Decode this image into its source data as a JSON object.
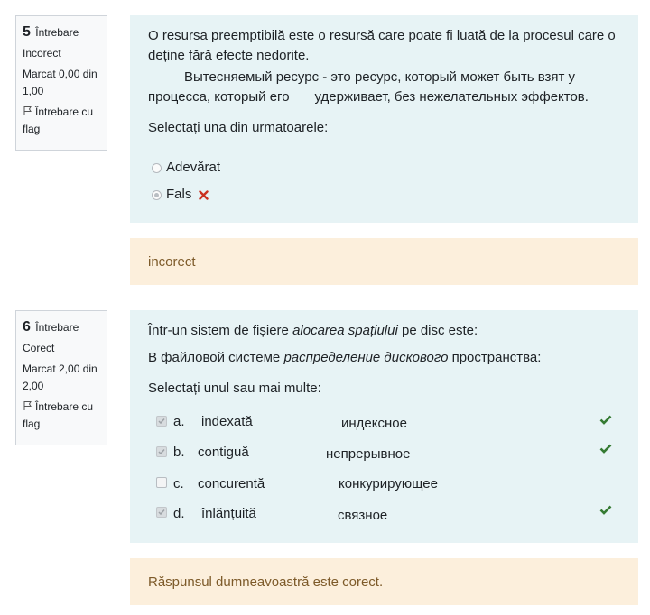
{
  "q5": {
    "number": "5",
    "label": "Întrebare",
    "state": "Incorect",
    "mark": "Marcat 0,00 din 1,00",
    "flag": "Întrebare cu flag",
    "text_ro": "O resursa preemptibilă este o resursă care poate fi luată de la procesul care o deține fără efecte nedorite.",
    "text_ru_1": "Вытесняемый ресурс - это ресурс, который может быть взят у",
    "text_ru_2a": "процесса, который его",
    "text_ru_2b": "удерживает, без нежелательных эффектов.",
    "prompt": "Selectați una din urmatoarele:",
    "options": [
      {
        "label": "Adevărat",
        "selected": false
      },
      {
        "label": "Fals",
        "selected": true,
        "mark": "incorrect-cross-icon"
      }
    ],
    "feedback": "incorect"
  },
  "q6": {
    "number": "6",
    "label": "Întrebare",
    "state": "Corect",
    "mark": "Marcat 2,00 din 2,00",
    "flag": "Întrebare cu flag",
    "text_ro_a": "Într-un sistem de fișiere ",
    "text_ro_em": "alocarea spațiului",
    "text_ro_b": " pe disc este:",
    "text_ru_a": "В файловой системе ",
    "text_ru_em": "распределение дискового",
    "text_ru_b": " пространства:",
    "prompt": "Selectați unul sau mai multe:",
    "options": [
      {
        "letter": "a.",
        "ro": "indexată",
        "ru": "индексное",
        "checked": true,
        "correct": true
      },
      {
        "letter": "b.",
        "ro": "contiguă",
        "ru": "непрерывное",
        "checked": true,
        "correct": true
      },
      {
        "letter": "c.",
        "ro": "concurentă",
        "ru": "конкурирующее",
        "checked": false,
        "correct": false
      },
      {
        "letter": "d.",
        "ro": "înlănțuită",
        "ru": "связное",
        "checked": true,
        "correct": true
      }
    ],
    "feedback": "Răspunsul dumneavoastră este corect."
  },
  "colors": {
    "formulation_bg": "#e7f3f5",
    "feedback_bg": "#fcefdc",
    "feedback_text": "#7d5a29",
    "correct_green": "#357a32",
    "incorrect_red": "#ca3120"
  }
}
